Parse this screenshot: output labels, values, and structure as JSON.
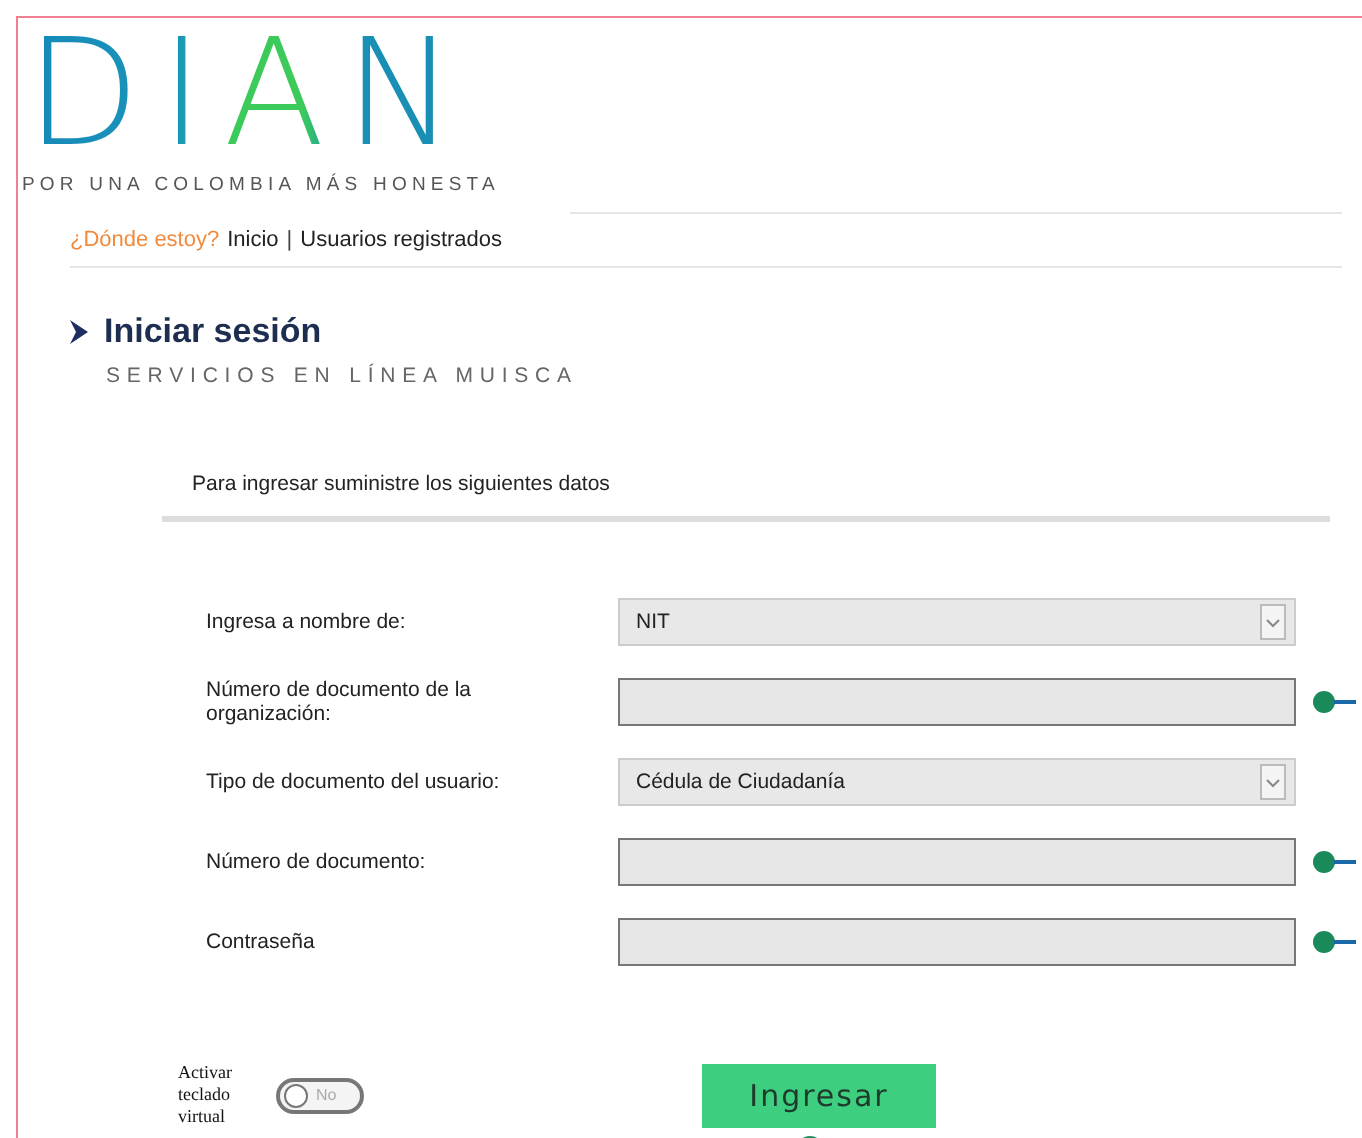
{
  "logo": {
    "text": "DIAN",
    "tagline": "POR UNA COLOMBIA MÁS HONESTA"
  },
  "breadcrumb": {
    "prompt": "¿Dónde estoy?",
    "items": [
      "Inicio",
      "Usuarios registrados"
    ],
    "separator": "|"
  },
  "heading": {
    "title": "Iniciar sesión",
    "subtitle": "SERVICIOS EN LÍNEA MUISCA"
  },
  "instructions": "Para ingresar suministre los siguientes datos",
  "fields": [
    {
      "kind": "select",
      "label": "Ingresa a nombre de:",
      "value": "NIT",
      "marker": false
    },
    {
      "kind": "text",
      "label": "Número de documento de la organización:",
      "marker": true
    },
    {
      "kind": "select",
      "label": "Tipo de documento del usuario:",
      "value": "Cédula de Ciudadanía",
      "marker": false
    },
    {
      "kind": "text",
      "label": "Número de documento:",
      "marker": true
    },
    {
      "kind": "password",
      "label": "Contraseña",
      "marker": true
    }
  ],
  "virtual_keyboard": {
    "label": "Activar teclado virtual",
    "on": false,
    "toggle_text": "No"
  },
  "submit": {
    "label": "Ingresar",
    "marker": true
  }
}
